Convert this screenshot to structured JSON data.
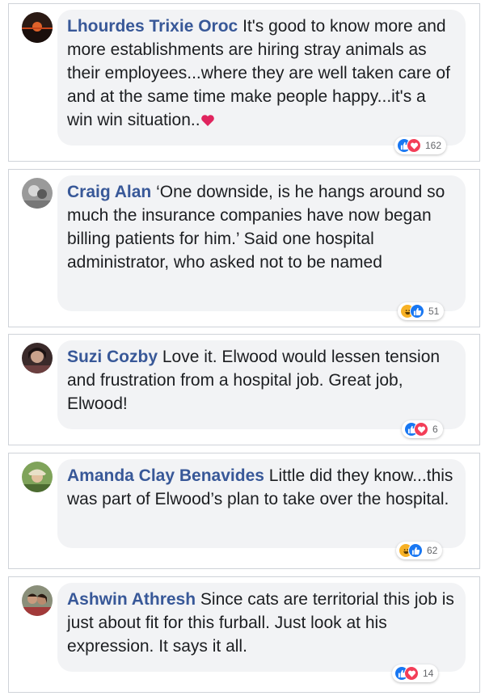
{
  "colors": {
    "author": "#385898",
    "bubble": "#f2f3f5",
    "text": "#1c1e21",
    "like": "#1877f2",
    "love": "#f33e58",
    "haha": "#f7b125"
  },
  "comments": [
    {
      "author": "Lhourdes Trixie Oroc",
      "text": "It's good to know more and more establishments are hiring stray animals as their employees...where they are well taken care of and at the same time make people happy...it's a win win situation..",
      "trailing_emoji": "heart-icon",
      "reactions": [
        "like-icon",
        "love-icon"
      ],
      "reaction_count": "162"
    },
    {
      "author": "Craig Alan",
      "text": "‘One downside, is he hangs around so much the insurance companies have now began billing patients for him.’ Said one hospital administrator, who asked not to be named",
      "reactions": [
        "haha-icon",
        "like-icon"
      ],
      "reaction_count": "51"
    },
    {
      "author": "Suzi Cozby",
      "text": "Love it. Elwood would lessen tension and frustration from a hospital job. Great job, Elwood!",
      "reactions": [
        "like-icon",
        "love-icon"
      ],
      "reaction_count": "6"
    },
    {
      "author": "Amanda Clay Benavides",
      "text": "Little did they know...this was part of Elwood’s plan to take over the hospital.",
      "reactions": [
        "haha-icon",
        "like-icon"
      ],
      "reaction_count": "62"
    },
    {
      "author": "Ashwin Athresh",
      "text": "Since cats are territorial this job is just about fit for this furball. Just look at his expression. It says it all.",
      "reactions": [
        "like-icon",
        "love-icon"
      ],
      "reaction_count": "14"
    }
  ]
}
